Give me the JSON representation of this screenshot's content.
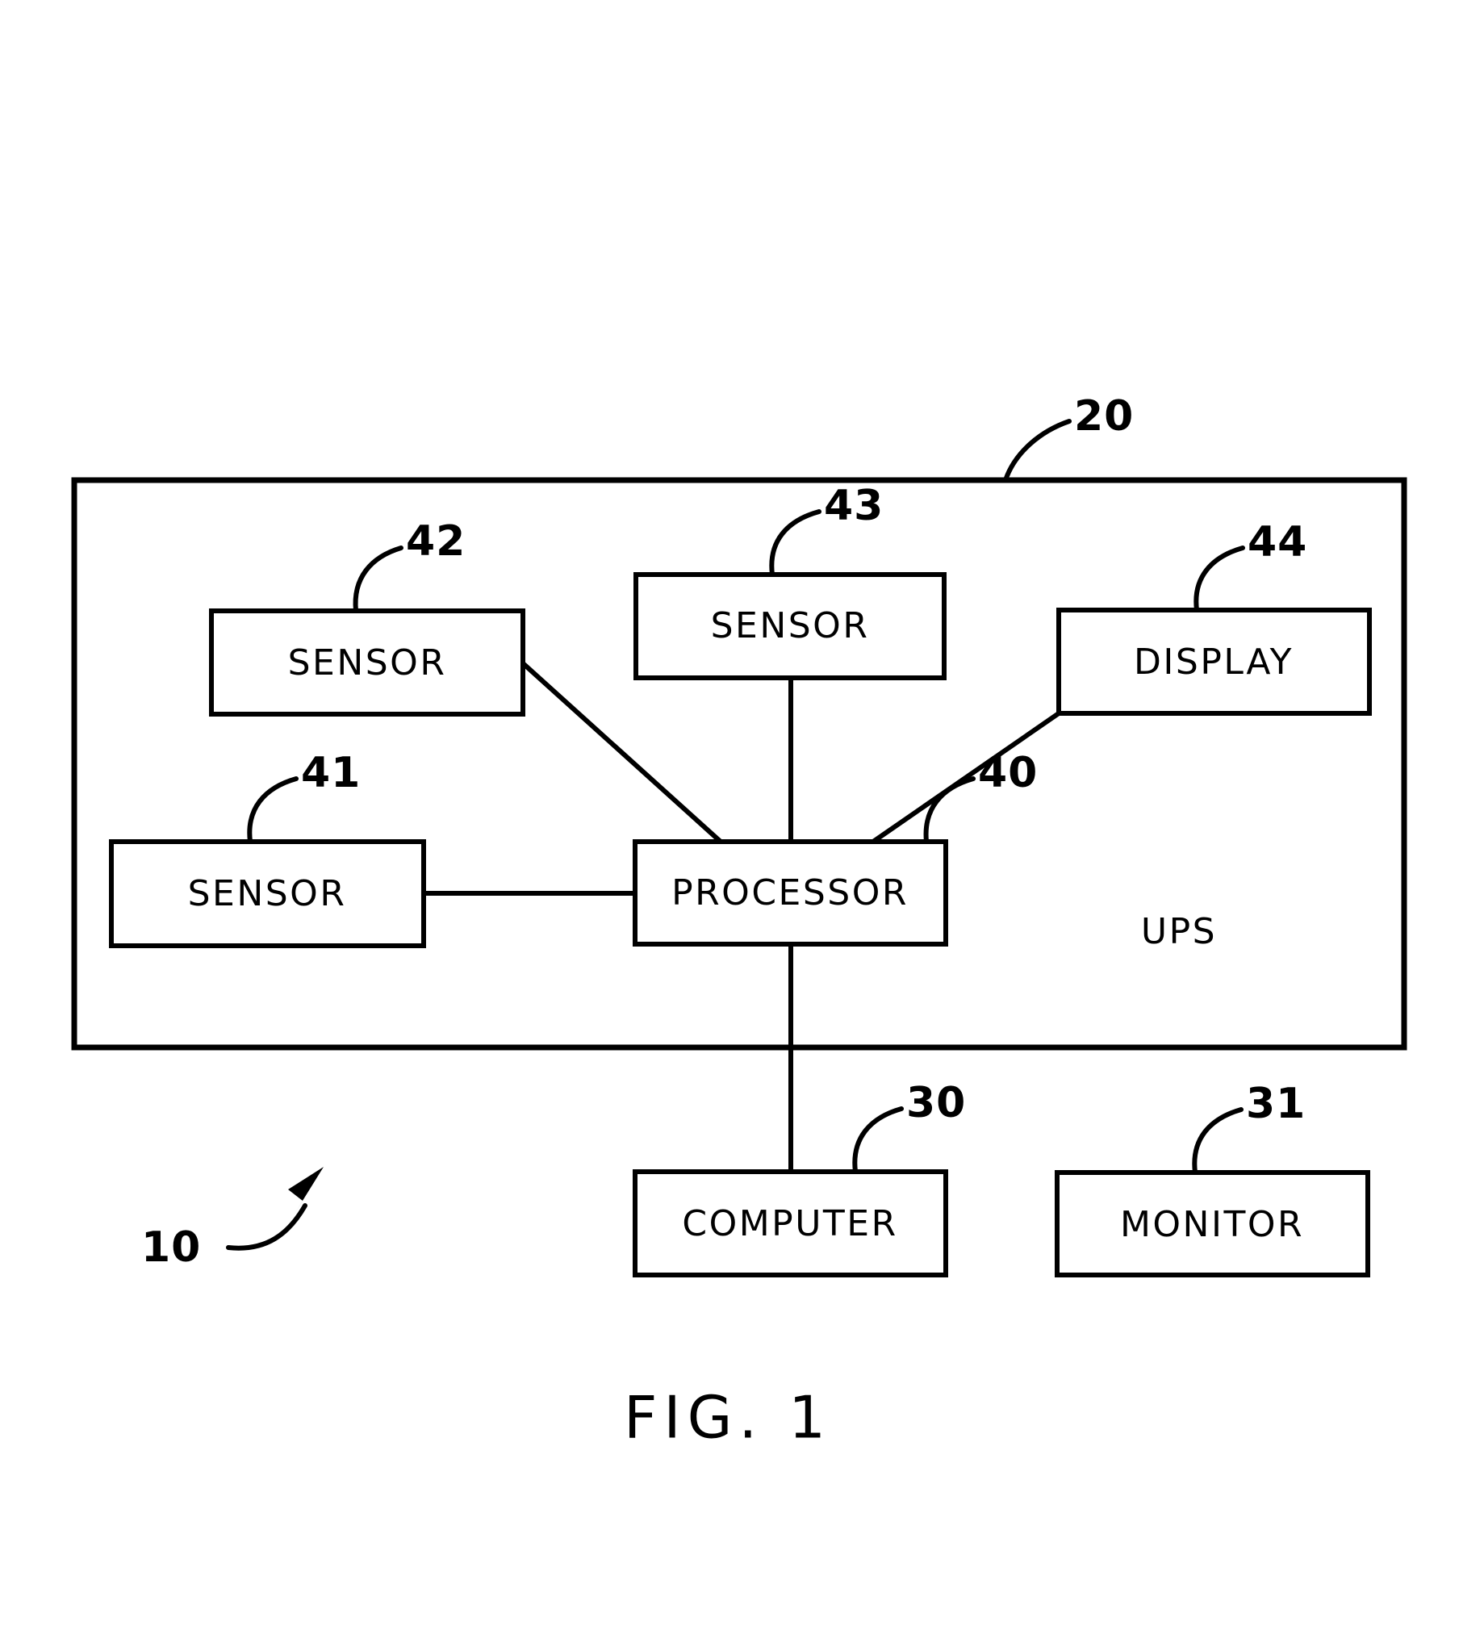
{
  "figure": {
    "caption": "FIG.  1",
    "system_reference": "10"
  },
  "enclosure": {
    "label": "UPS",
    "reference": "20"
  },
  "blocks": [
    {
      "id": "sensor-42",
      "label": "SENSOR",
      "reference": "42"
    },
    {
      "id": "sensor-43",
      "label": "SENSOR",
      "reference": "43"
    },
    {
      "id": "display-44",
      "label": "DISPLAY",
      "reference": "44"
    },
    {
      "id": "sensor-41",
      "label": "SENSOR",
      "reference": "41"
    },
    {
      "id": "processor-40",
      "label": "PROCESSOR",
      "reference": "40"
    },
    {
      "id": "computer-30",
      "label": "COMPUTER",
      "reference": "30"
    },
    {
      "id": "monitor-31",
      "label": "MONITOR",
      "reference": "31"
    }
  ],
  "colors": {
    "line": "#000000",
    "background": "#ffffff",
    "text": "#000000"
  }
}
